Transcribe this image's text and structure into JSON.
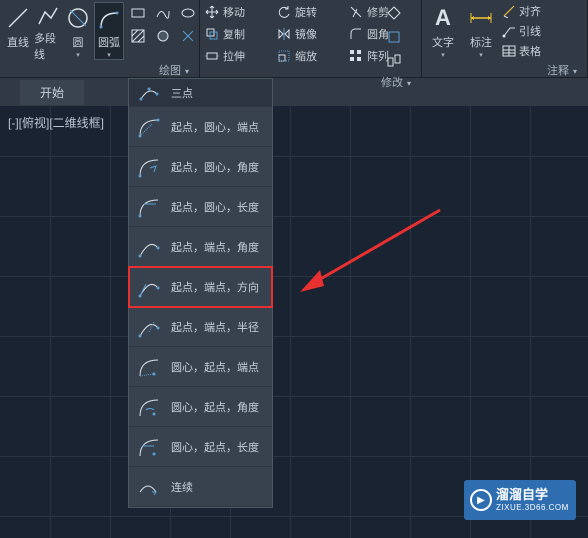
{
  "ribbon": {
    "draw_group": {
      "title": "绘图",
      "line": "直线",
      "polyline": "多段线",
      "circle": "圆",
      "arc": "圆弧"
    },
    "modify_group": {
      "title": "修改",
      "move": "移动",
      "copy": "复制",
      "stretch": "拉伸",
      "rotate": "旋转",
      "mirror": "镜像",
      "scale": "缩放",
      "trim": "修剪",
      "fillet": "圆角",
      "array": "阵列"
    },
    "anno_group": {
      "title": "注释",
      "text": "文字",
      "dim": "标注",
      "align": "对齐",
      "leader": "引线",
      "table": "表格"
    }
  },
  "tabs": {
    "start": "开始"
  },
  "viewport": {
    "label": "[-][俯视][二维线框]"
  },
  "arc_menu": {
    "items": [
      "三点",
      "起点，圆心，端点",
      "起点，圆心，角度",
      "起点，圆心，长度",
      "起点，端点，角度",
      "起点，端点，方向",
      "起点，端点，半径",
      "圆心，起点，端点",
      "圆心，起点，角度",
      "圆心，起点，长度",
      "连续"
    ]
  },
  "watermark": {
    "main": "溜溜自学",
    "sub": "ZIXUE.3D66.COM"
  }
}
